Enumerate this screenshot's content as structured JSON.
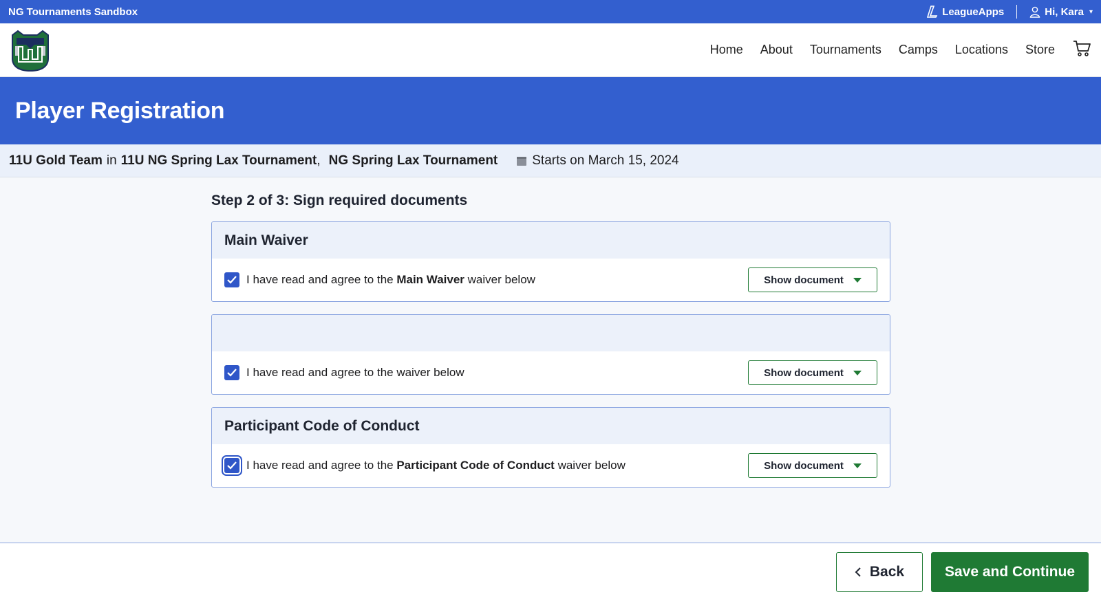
{
  "topbar": {
    "site_name": "NG Tournaments Sandbox",
    "brand": "LeagueApps",
    "greeting": "Hi, Kara"
  },
  "nav": {
    "items": [
      {
        "label": "Home"
      },
      {
        "label": "About"
      },
      {
        "label": "Tournaments"
      },
      {
        "label": "Camps"
      },
      {
        "label": "Locations"
      },
      {
        "label": "Store"
      }
    ]
  },
  "hero": {
    "title": "Player Registration"
  },
  "subhead": {
    "team": "11U Gold Team",
    "in": "in",
    "program": "11U NG Spring Lax Tournament",
    "separator": ",",
    "event": "NG Spring Lax Tournament",
    "start": "Starts on March 15, 2024"
  },
  "step": {
    "title": "Step 2 of 3: Sign required documents"
  },
  "documents": [
    {
      "title": "Main Waiver",
      "prefix": "I have read and agree to the",
      "name": "Main Waiver",
      "suffix": "waiver below",
      "checked": true,
      "button": "Show document"
    },
    {
      "title": "",
      "prefix": "I have read and agree to the waiver below",
      "name": "",
      "suffix": "",
      "checked": true,
      "button": "Show document"
    },
    {
      "title": "Participant Code of Conduct",
      "prefix": "I have read and agree to the",
      "name": "Participant Code of Conduct",
      "suffix": "waiver below",
      "checked": true,
      "button": "Show document"
    }
  ],
  "footer": {
    "back": "Back",
    "save": "Save and Continue"
  },
  "colors": {
    "primary_blue": "#335fcf",
    "green": "#1f7a34",
    "light_blue_bg": "#eaf0fa"
  }
}
